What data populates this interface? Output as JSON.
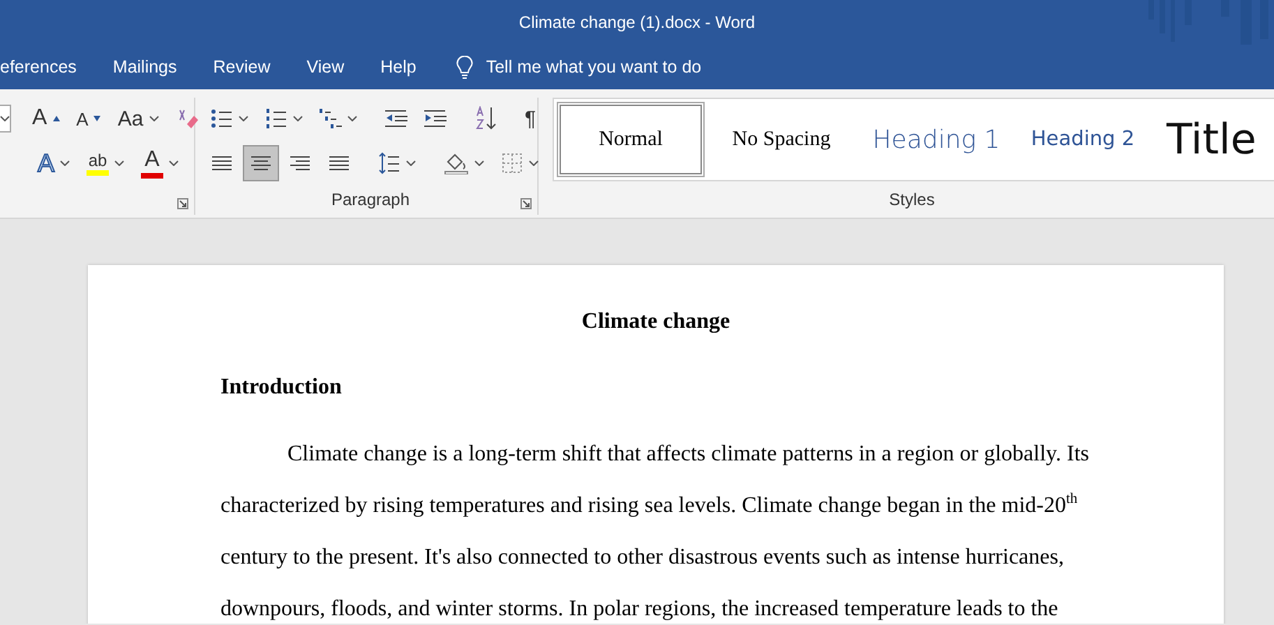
{
  "window": {
    "title": "Climate change (1).docx  -  Word"
  },
  "tabs": [
    {
      "label": "eferences",
      "selected": false
    },
    {
      "label": "Mailings",
      "selected": false
    },
    {
      "label": "Review",
      "selected": false
    },
    {
      "label": "View",
      "selected": false
    },
    {
      "label": "Help",
      "selected": false
    }
  ],
  "tell_me": {
    "placeholder": "Tell me what you want to do"
  },
  "font_group": {
    "row_1": [
      {
        "kind": "size_box",
        "has_menu": true
      },
      {
        "kind": "grow",
        "label": "A",
        "has_menu": false
      },
      {
        "kind": "shrink",
        "label": "A",
        "has_menu": false
      },
      {
        "kind": "case",
        "label": "Aa",
        "has_menu": true
      },
      {
        "kind": "clear",
        "has_menu": false
      }
    ],
    "row_2": [
      {
        "kind": "effects",
        "label": "A",
        "has_menu": true
      },
      {
        "kind": "highlight",
        "label": "ab",
        "color": "#ffff00",
        "has_menu": true
      },
      {
        "kind": "font_color",
        "label": "A",
        "color": "#e00000",
        "has_menu": true
      }
    ]
  },
  "paragraph_group": {
    "title": "Paragraph",
    "row_1": [
      {
        "kind": "bullets",
        "has_menu": true
      },
      {
        "kind": "numbering",
        "has_menu": true
      },
      {
        "kind": "multilevel",
        "has_menu": true
      },
      {
        "kind": "sep"
      },
      {
        "kind": "outdent",
        "has_menu": false
      },
      {
        "kind": "indent",
        "has_menu": false
      },
      {
        "kind": "sep"
      },
      {
        "kind": "sort",
        "has_menu": false
      },
      {
        "kind": "sep"
      },
      {
        "kind": "marks",
        "label": "¶",
        "has_menu": false
      }
    ],
    "row_2": [
      {
        "kind": "align_left",
        "selected": false,
        "has_menu": false
      },
      {
        "kind": "align_center",
        "selected": true,
        "has_menu": false
      },
      {
        "kind": "align_right",
        "selected": false,
        "has_menu": false
      },
      {
        "kind": "justify",
        "selected": false,
        "has_menu": false
      },
      {
        "kind": "sep"
      },
      {
        "kind": "spacing",
        "has_menu": true
      },
      {
        "kind": "sep"
      },
      {
        "kind": "shading",
        "has_menu": true
      },
      {
        "kind": "borders",
        "has_menu": true
      }
    ]
  },
  "styles_group": {
    "title": "Styles",
    "items": [
      {
        "kind": "normal",
        "label": "Normal",
        "selected": true
      },
      {
        "kind": "no_spacing",
        "label": "No Spacing",
        "selected": false
      },
      {
        "kind": "heading_1",
        "label": "Heading 1",
        "selected": false
      },
      {
        "kind": "heading_2",
        "label": "Heading 2",
        "selected": false
      },
      {
        "kind": "title",
        "label": "Title",
        "selected": false
      }
    ]
  },
  "document": {
    "title": "Climate change",
    "heading": "Introduction",
    "paragraph": "Climate change is a long-term shift that affects climate patterns in a region or globally. Its characterized by rising temperatures and rising sea levels. Climate change began in the mid-20$^{th}$ century to the present. It's also connected to other disastrous events such as intense hurricanes, downpours, floods, and winter storms. In polar regions, the increased temperature leads to the"
  }
}
